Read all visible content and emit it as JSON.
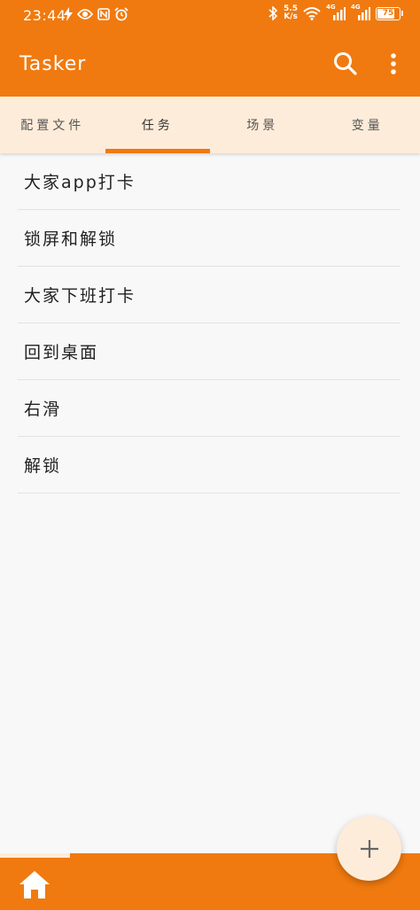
{
  "status_bar": {
    "time": "23:44",
    "speed_value": "5.5",
    "speed_unit": "K/s",
    "battery": "75",
    "signal_label_1": "4G",
    "signal_label_2": "4G"
  },
  "app_bar": {
    "title": "Tasker"
  },
  "tabs": [
    {
      "label": "配置文件",
      "active": false
    },
    {
      "label": "任务",
      "active": true
    },
    {
      "label": "场景",
      "active": false
    },
    {
      "label": "变量",
      "active": false
    }
  ],
  "tasks": [
    {
      "name": "大家app打卡"
    },
    {
      "name": "锁屏和解锁"
    },
    {
      "name": "大家下班打卡"
    },
    {
      "name": "回到桌面"
    },
    {
      "name": "右滑"
    },
    {
      "name": "解锁"
    }
  ],
  "colors": {
    "primary": "#f07a0f",
    "tab_background": "#fdecd9",
    "list_background": "#f8f8f8"
  },
  "icons": {
    "search": "search-icon",
    "more": "more-vert-icon",
    "add": "plus-icon",
    "home": "home-icon"
  }
}
